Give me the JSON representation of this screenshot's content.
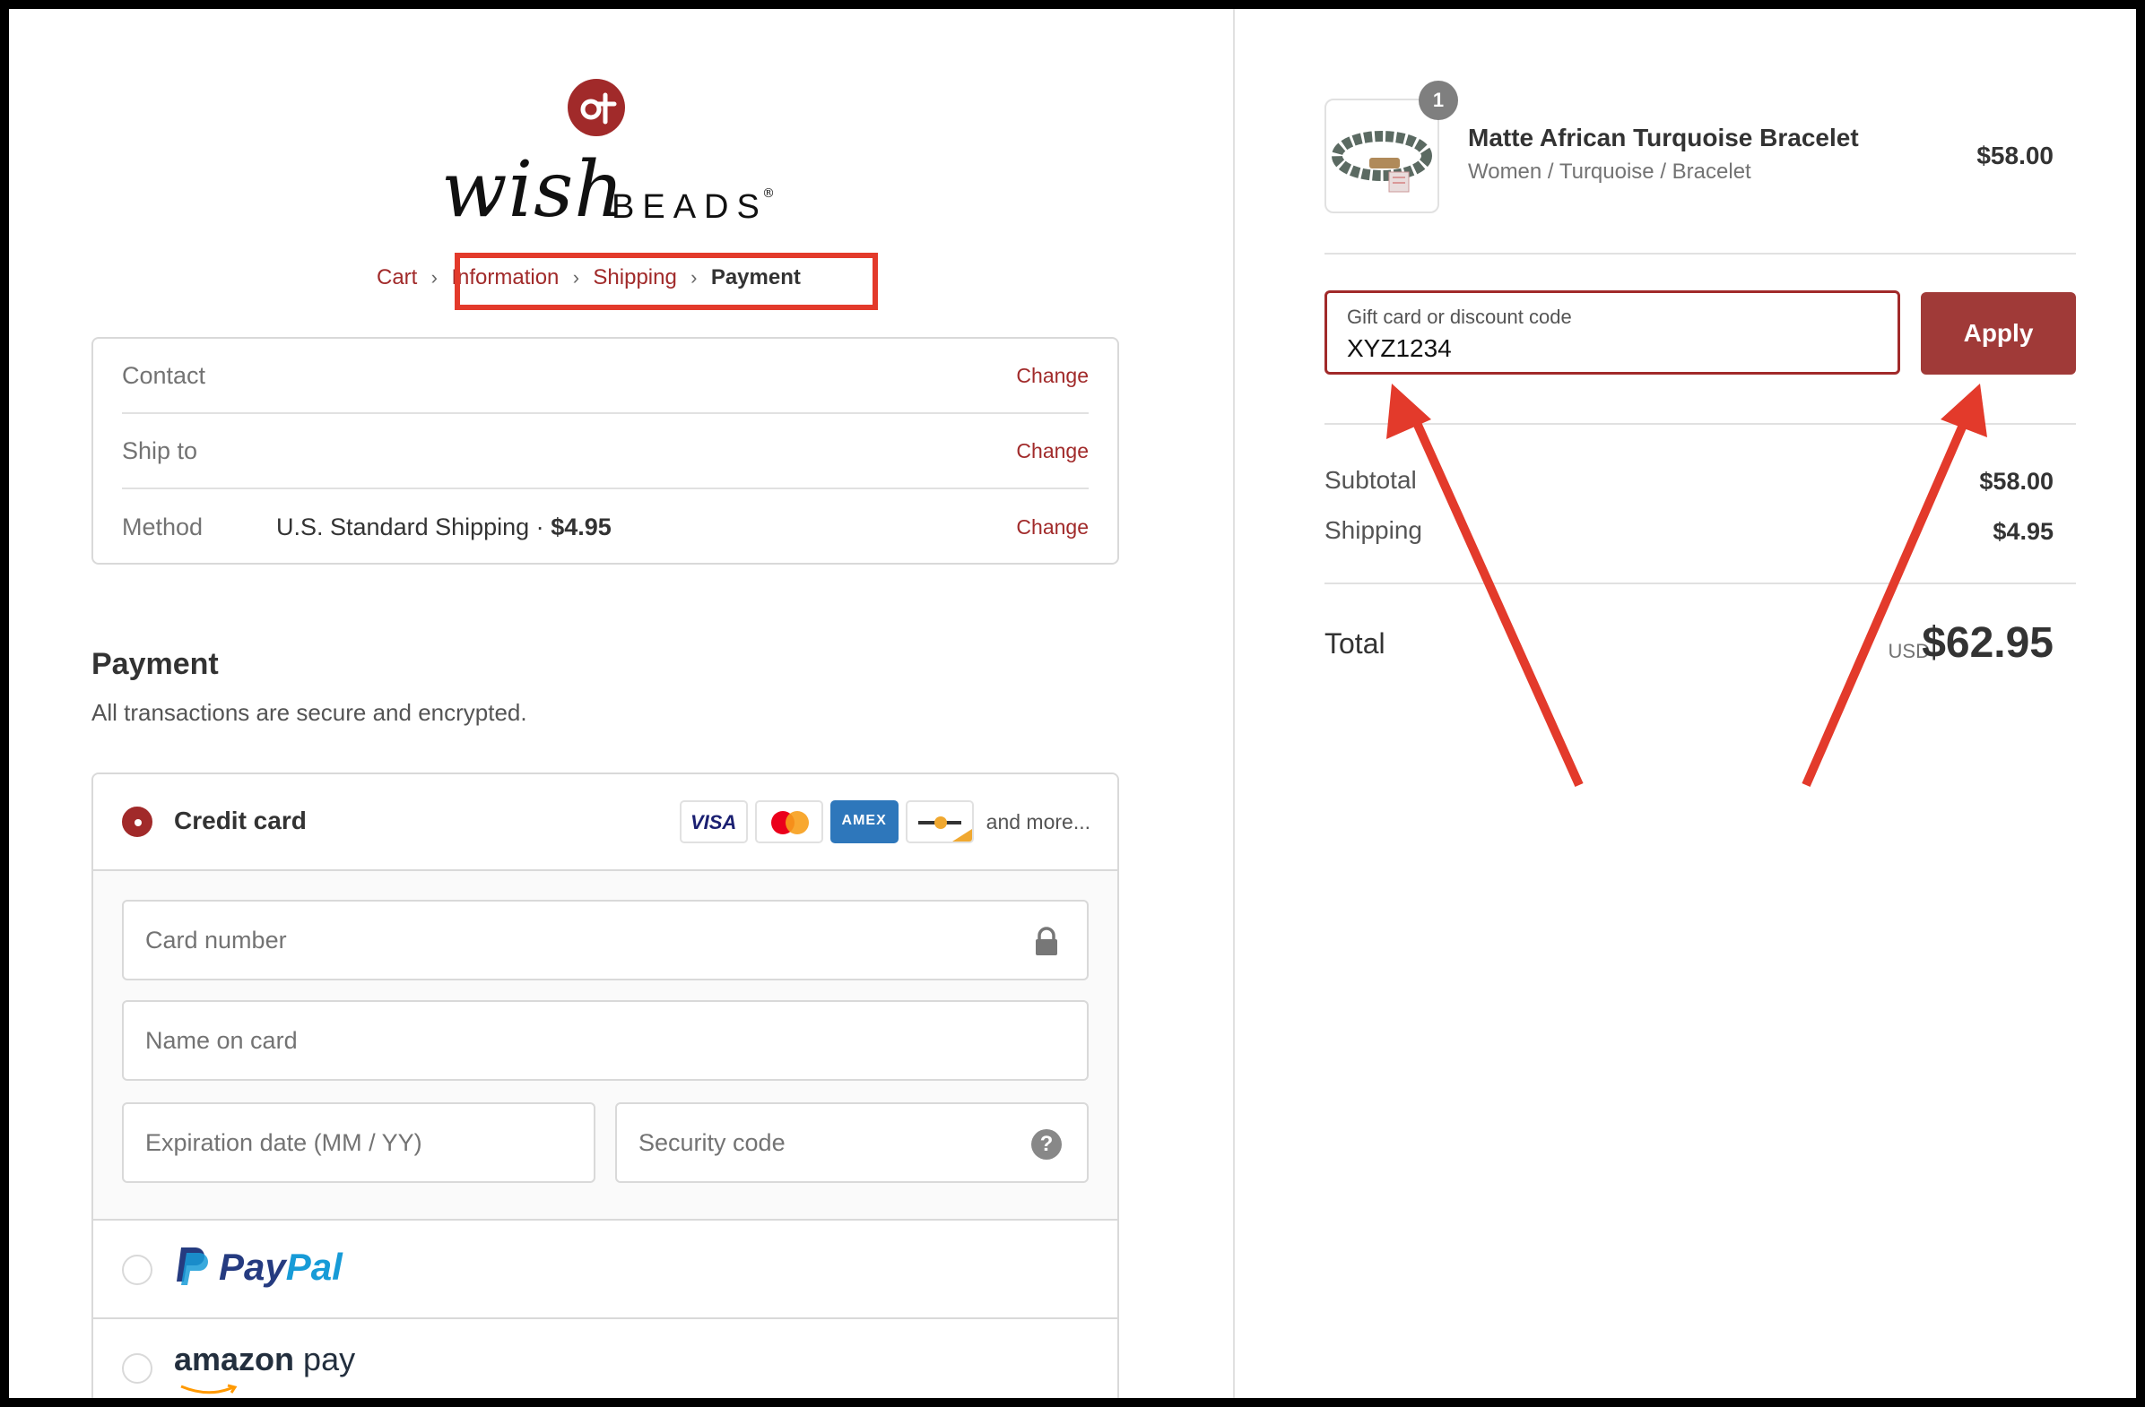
{
  "brand": {
    "logo_wordmark": "wishBEADS",
    "logo_colors": {
      "circle": "#a12a2a",
      "text": "#111111"
    }
  },
  "breadcrumb": {
    "items": [
      {
        "label": "Cart",
        "current": false
      },
      {
        "label": "Information",
        "current": false
      },
      {
        "label": "Shipping",
        "current": false
      },
      {
        "label": "Payment",
        "current": true
      }
    ]
  },
  "summary": {
    "contact": {
      "label": "Contact",
      "value": "",
      "change": "Change"
    },
    "ship_to": {
      "label": "Ship to",
      "value": "",
      "change": "Change"
    },
    "method": {
      "label": "Method",
      "value": "U.S. Standard Shipping · ",
      "price": "$4.95",
      "change": "Change"
    }
  },
  "payment": {
    "title": "Payment",
    "subtitle": "All transactions are secure and encrypted.",
    "credit_card": {
      "label": "Credit card",
      "selected": true,
      "card_brands": [
        "VISA",
        "mastercard",
        "AMEX",
        "generic-card"
      ],
      "visa_text": "VISA",
      "amex_text": "AMEX",
      "and_more": "and more...",
      "fields": {
        "card_number": "Card number",
        "name_on_card": "Name on card",
        "expiration": "Expiration date (MM / YY)",
        "security_code": "Security code"
      },
      "help_glyph": "?"
    },
    "paypal": {
      "label_pay": "Pay",
      "label_pal": "Pal",
      "selected": false
    },
    "amazon_pay": {
      "label_amazon": "amazon",
      "label_pay": " pay",
      "selected": false
    }
  },
  "order": {
    "item": {
      "quantity": "1",
      "name": "Matte African Turquoise Bracelet",
      "variant": "Women / Turquoise / Bracelet",
      "price": "$58.00"
    },
    "discount": {
      "label": "Gift card or discount code",
      "value": "XYZ1234",
      "apply_label": "Apply"
    },
    "subtotal": {
      "label": "Subtotal",
      "value": "$58.00"
    },
    "shipping": {
      "label": "Shipping",
      "value": "$4.95"
    },
    "total": {
      "label": "Total",
      "currency": "USD",
      "value": "$62.95"
    }
  },
  "colors": {
    "accent": "#a12a2a",
    "apply_button": "#a03a38",
    "annotation": "#e33a2b"
  }
}
